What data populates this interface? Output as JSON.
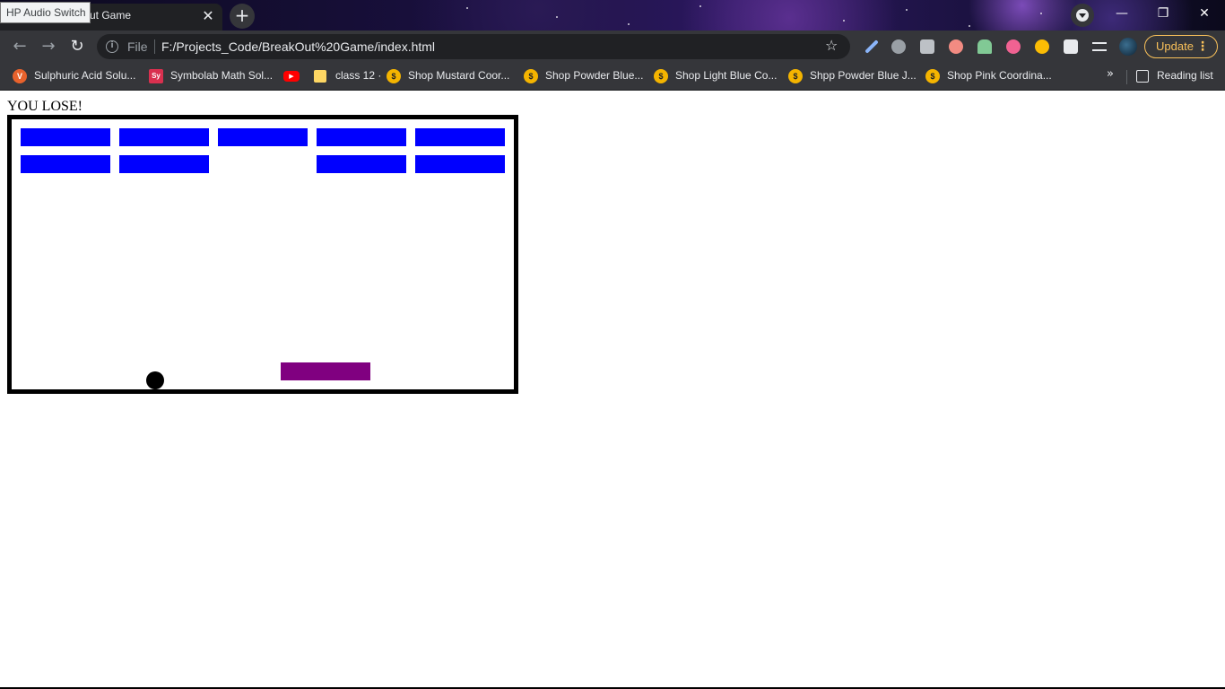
{
  "browser": {
    "tab": {
      "title": "BreakOut Game",
      "visible_title": "ut Game",
      "close_glyph": "✕"
    },
    "tooltip": "HP Audio Switch",
    "new_tab_glyph": "+",
    "window_controls": {
      "minimize": "—",
      "restore": "❐",
      "close": "✕"
    },
    "nav": {
      "back": "←",
      "forward": "→",
      "reload": "↻"
    },
    "omnibox": {
      "scheme_label": "File",
      "url": "F:/Projects_Code/BreakOut%20Game/index.html",
      "bookmark_glyph": "☆"
    },
    "update_button": {
      "label": "Update",
      "menu_glyph": "⋮"
    },
    "bookmarks": [
      {
        "label": "Sulphuric Acid Solu...",
        "icon": "V",
        "icon_color": "#e8622c"
      },
      {
        "label": "Symbolab Math Sol...",
        "icon": "Sy",
        "icon_color": "#d9304f"
      },
      {
        "label": "",
        "icon": "▶",
        "icon_color": "#ff0000"
      },
      {
        "label": "class 12 ·",
        "icon": "",
        "icon_color": "#fdd663"
      },
      {
        "label": "Shop Mustard Coor...",
        "icon": "$",
        "icon_color": "#f4b400"
      },
      {
        "label": "Shop Powder Blue...",
        "icon": "$",
        "icon_color": "#f4b400"
      },
      {
        "label": "Shop Light Blue Co...",
        "icon": "$",
        "icon_color": "#f4b400"
      },
      {
        "label": "Shpp Powder Blue J...",
        "icon": "$",
        "icon_color": "#f4b400"
      },
      {
        "label": "Shop Pink Coordina...",
        "icon": "$",
        "icon_color": "#f4b400"
      }
    ],
    "more_bookmarks_glyph": "»",
    "reading_list_label": "Reading list"
  },
  "game": {
    "status_text": "YOU LOSE!",
    "colors": {
      "brick": "#0000ff",
      "paddle": "#800080",
      "ball": "#000000",
      "border": "#000000"
    },
    "bricks": [
      [
        true,
        true,
        true,
        true,
        true
      ],
      [
        true,
        true,
        false,
        true,
        true
      ]
    ]
  }
}
